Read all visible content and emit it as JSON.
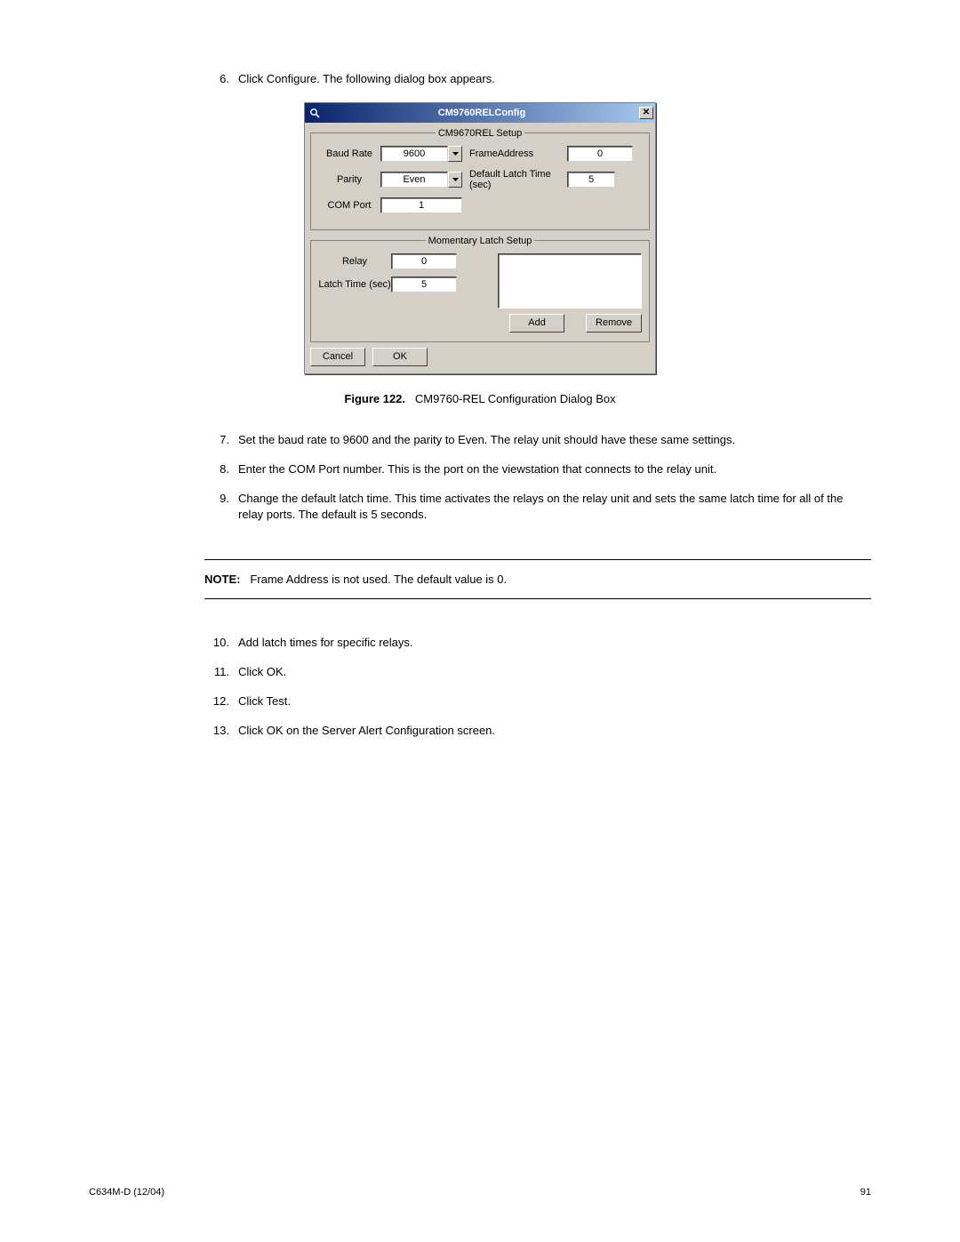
{
  "steps_a": [
    {
      "n": "6.",
      "t": "Click Configure. The following dialog box appears."
    }
  ],
  "dialog": {
    "title": "CM9760RELConfig",
    "group1": {
      "legend": "CM9670REL Setup",
      "baud_label": "Baud Rate",
      "baud_value": "9600",
      "parity_label": "Parity",
      "parity_value": "Even",
      "com_label": "COM Port",
      "com_value": "1",
      "frame_label": "FrameAddress",
      "frame_value": "0",
      "deflatch_label": "Default Latch Time (sec)",
      "deflatch_value": "5"
    },
    "group2": {
      "legend": "Momentary Latch Setup",
      "relay_label": "Relay",
      "relay_value": "0",
      "latch_label": "Latch Time (sec)",
      "latch_value": "5",
      "add": "Add",
      "remove": "Remove"
    },
    "cancel": "Cancel",
    "ok": "OK"
  },
  "figure": {
    "label": "Figure 122.",
    "caption": "CM9760-REL Configuration Dialog Box"
  },
  "steps_b": [
    {
      "n": "7.",
      "t": "Set the baud rate to 9600 and the parity to Even. The relay unit should have these same settings."
    },
    {
      "n": "8.",
      "t": "Enter the COM Port number. This is the port on the viewstation that connects to the relay unit."
    },
    {
      "n": "9.",
      "t": "Change the default latch time. This time activates the relays on the relay unit and sets the same latch time for all of the relay ports. The default is 5 seconds."
    }
  ],
  "note": {
    "label": "NOTE:",
    "text": "Frame Address is not used. The default value is 0."
  },
  "steps_c": [
    {
      "n": "10.",
      "t": "Add latch times for specific relays."
    },
    {
      "n": "11.",
      "t": "Click OK."
    },
    {
      "n": "12.",
      "t": "Click Test."
    },
    {
      "n": "13.",
      "t": "Click OK on the Server Alert Configuration screen."
    }
  ],
  "footer": {
    "left": "C634M-D (12/04)",
    "right": "91"
  }
}
